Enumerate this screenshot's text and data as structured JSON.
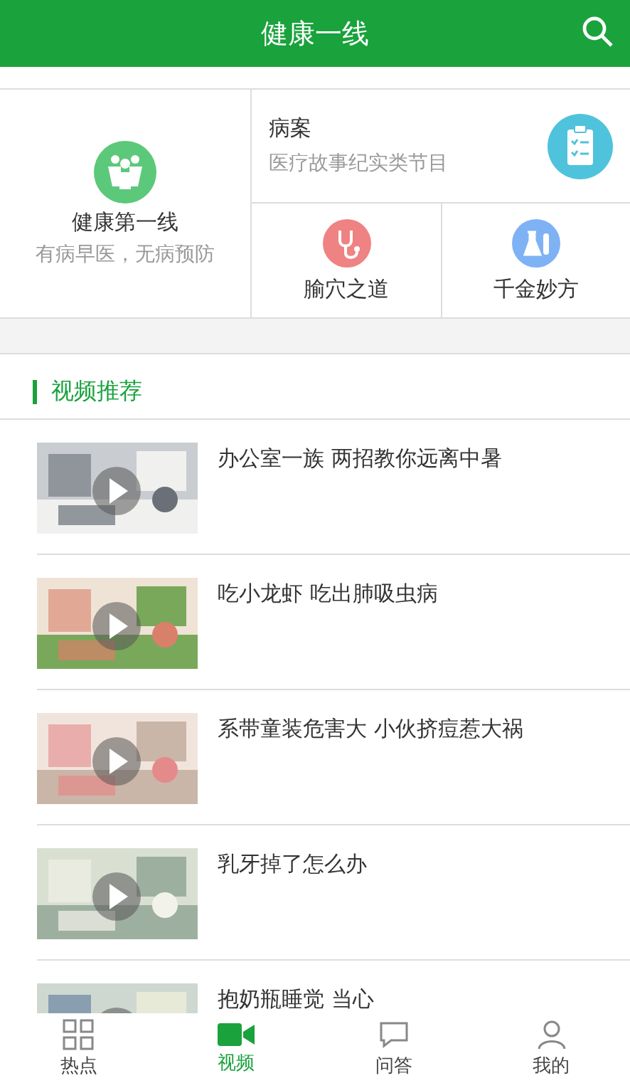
{
  "header": {
    "title": "健康一线"
  },
  "features": {
    "main": {
      "title": "健康第一线",
      "subtitle": "有病早医，无病预防"
    },
    "case": {
      "title": "病案",
      "subtitle": "医疗故事纪实类节目"
    },
    "small": [
      {
        "kind": "stethoscope",
        "title": "腧穴之道"
      },
      {
        "kind": "flask",
        "title": "千金妙方"
      }
    ]
  },
  "section": {
    "title": "视频推荐"
  },
  "videos": [
    {
      "title": "办公室一族 两招教你远离中暑"
    },
    {
      "title": "吃小龙虾 吃出肺吸虫病"
    },
    {
      "title": "系带童装危害大 小伙挤痘惹大祸"
    },
    {
      "title": "乳牙掉了怎么办"
    },
    {
      "title": "抱奶瓶睡觉 当心"
    }
  ],
  "tabs": [
    {
      "kind": "grid",
      "label": "热点",
      "selected": false
    },
    {
      "kind": "video",
      "label": "视频",
      "selected": true
    },
    {
      "kind": "chat",
      "label": "问答",
      "selected": false
    },
    {
      "kind": "person",
      "label": "我的",
      "selected": false
    }
  ]
}
